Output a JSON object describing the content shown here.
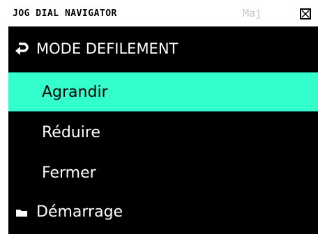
{
  "window": {
    "title": "JOG DIAL NAVIGATOR",
    "shift_indicator": "Maj",
    "close_icon": "close-box-icon"
  },
  "mode": {
    "icon": "return-arrow-icon",
    "label": "MODE DEFILEMENT"
  },
  "menu": {
    "items": [
      {
        "label": "Agrandir",
        "selected": true
      },
      {
        "label": "Réduire",
        "selected": false
      },
      {
        "label": "Fermer",
        "selected": false
      },
      {
        "label": "Démarrage",
        "icon": "folder-icon",
        "selected": false
      }
    ]
  },
  "colors": {
    "highlight": "#33ffcc",
    "background": "#000000",
    "titlebar": "#ffffff",
    "shift_indicator": "#c8c8c8"
  }
}
